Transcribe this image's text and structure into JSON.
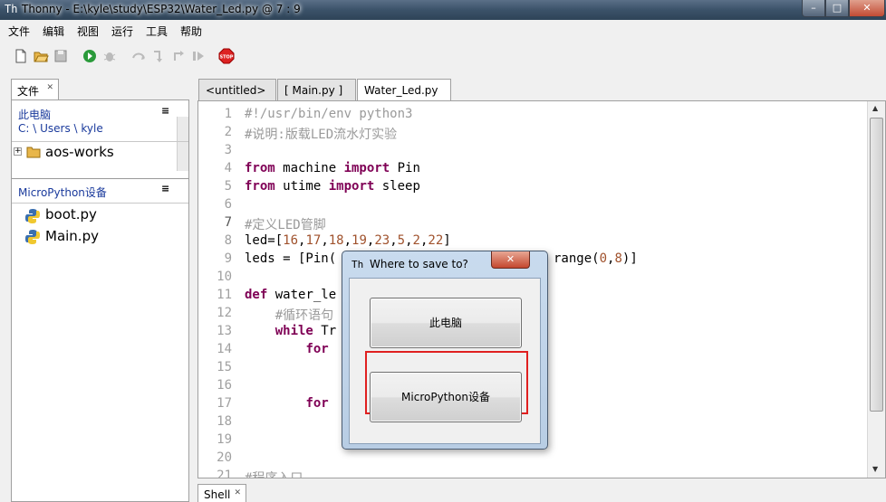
{
  "window": {
    "title": "Thonny  -  E:\\kyle\\study\\ESP32\\Water_Led.py  @  7 : 9",
    "min": "–",
    "max": "□",
    "close": "✕"
  },
  "menu": [
    "文件",
    "编辑",
    "视图",
    "运行",
    "工具",
    "帮助"
  ],
  "toolbar_icons": [
    "new-file-icon",
    "open-file-icon",
    "save-icon",
    "run-icon",
    "debug-icon",
    "step-over-icon",
    "step-into-icon",
    "step-out-icon",
    "resume-icon",
    "stop-icon"
  ],
  "files_panel": {
    "tab_label": "文件",
    "this_computer": "此电脑",
    "path": "C: \\ Users \\ kyle",
    "folder": "aos-works",
    "device_head": "MicroPython设备",
    "device_files": [
      "boot.py",
      "Main.py"
    ],
    "menu_glyph": "≡"
  },
  "editor_tabs": [
    "<untitled>",
    "[ Main.py ]",
    "Water_Led.py"
  ],
  "line_numbers": [
    "1",
    "2",
    "3",
    "4",
    "5",
    "6",
    "7",
    "8",
    "9",
    "10",
    "11",
    "12",
    "13",
    "14",
    "15",
    "16",
    "17",
    "18",
    "19",
    "20",
    "21"
  ],
  "code_lines": [
    "#!/usr/bin/env python3",
    "#说明:版载LED流水灯实验",
    "",
    "from machine import Pin",
    "from utime import sleep",
    "",
    "#定义LED管脚",
    "led=[16,17,18,19,23,5,2,22]",
    "leds = [Pin(",
    "range(0,8)]",
    "def water_le",
    "    #循环语句",
    "    while Tr",
    "        for",
    "        for",
    "#程序入口"
  ],
  "shell_tab": "Shell",
  "dialog": {
    "title": "Where to save to?",
    "button_computer": "此电脑",
    "button_device": "MicroPython设备"
  }
}
